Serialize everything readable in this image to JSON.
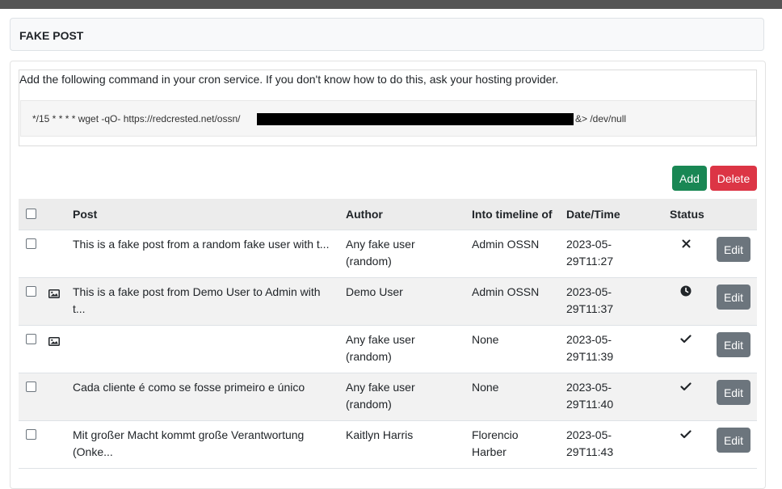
{
  "header": {
    "title": "FAKE POST"
  },
  "cron": {
    "instruction": "Add the following command in your cron service. If you don't know how to do this, ask your hosting provider.",
    "command_prefix": "*/15 * * * * wget -qO- https://redcrested.net/ossn/",
    "command_suffix": "&> /dev/null"
  },
  "actions": {
    "add_label": "Add",
    "delete_label": "Delete"
  },
  "table": {
    "columns": {
      "post": "Post",
      "author": "Author",
      "timeline": "Into timeline of",
      "datetime": "Date/Time",
      "status": "Status"
    },
    "edit_label": "Edit",
    "rows": [
      {
        "post": "This is a fake post from a random fake user with t...",
        "author": "Any fake user (random)",
        "timeline": "Admin OSSN",
        "date": "2023-05-",
        "time": "29T11:27",
        "status_icon": "times-icon",
        "has_image": false
      },
      {
        "post": "This is a fake post from Demo User to Admin with t...",
        "author": "Demo User",
        "timeline": "Admin OSSN",
        "date": "2023-05-",
        "time": "29T11:37",
        "status_icon": "clock-icon",
        "has_image": true
      },
      {
        "post": "",
        "author": "Any fake user (random)",
        "timeline": "None",
        "date": "2023-05-",
        "time": "29T11:39",
        "status_icon": "check-icon",
        "has_image": true
      },
      {
        "post": "Cada cliente é como se fosse primeiro e único",
        "author": "Any fake user (random)",
        "timeline": "None",
        "date": "2023-05-",
        "time": "29T11:40",
        "status_icon": "check-icon",
        "has_image": false
      },
      {
        "post": "Mit großer Macht kommt große Verantwortung (Onke...",
        "author": "Kaitlyn Harris",
        "timeline": "Florencio Harber",
        "date": "2023-05-",
        "time": "29T11:43",
        "status_icon": "check-icon",
        "has_image": false
      }
    ]
  }
}
